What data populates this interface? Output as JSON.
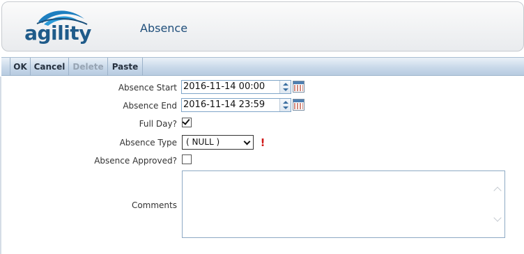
{
  "header": {
    "logo_text": "agility",
    "title": "Absence"
  },
  "toolbar": {
    "ok_label": "OK",
    "cancel_label": "Cancel",
    "delete_label": "Delete",
    "paste_label": "Paste"
  },
  "form": {
    "absence_start": {
      "label": "Absence Start",
      "value": "2016-11-14 00:00"
    },
    "absence_end": {
      "label": "Absence End",
      "value": "2016-11-14 23:59"
    },
    "full_day": {
      "label": "Full Day?",
      "checked": true
    },
    "absence_type": {
      "label": "Absence Type",
      "value": "( NULL )",
      "required_mark": "!"
    },
    "absence_approved": {
      "label": "Absence Approved?",
      "checked": false
    },
    "comments": {
      "label": "Comments",
      "value": ""
    }
  },
  "colors": {
    "accent": "#1f5b8a",
    "toolbar_bg": "#c9d9ea",
    "required": "#d01818"
  },
  "icons": [
    "calendar-icon",
    "spin-up-icon",
    "spin-down-icon",
    "check-icon",
    "chevron-down-icon",
    "required-icon"
  ]
}
